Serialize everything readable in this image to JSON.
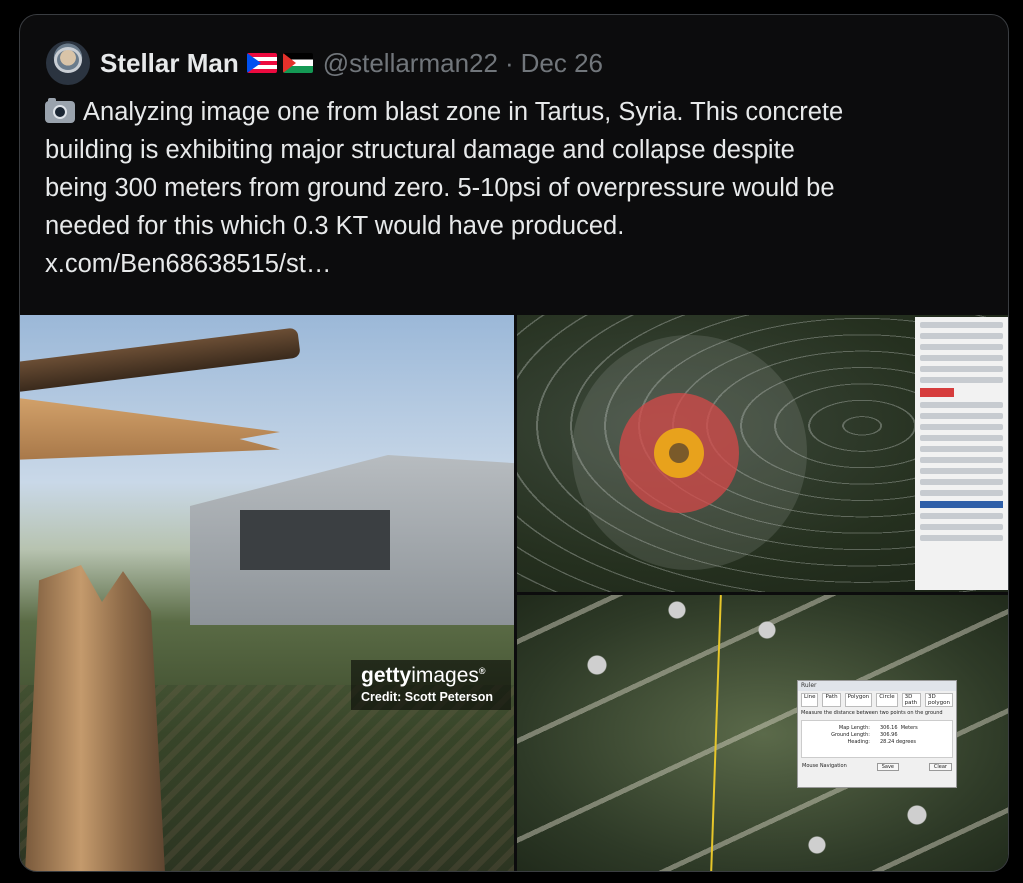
{
  "post": {
    "author_name": "Stellar Man",
    "flags": [
      "puerto-rico-flag",
      "palestine-flag"
    ],
    "handle": "@stellarman22",
    "separator": "·",
    "date": "Dec 26",
    "text_lines": [
      "Analyzing image one from blast zone in Tartus, Syria. This concrete",
      "building is exhibiting major structural damage and collapse despite",
      "being 300 meters from ground zero. 5-10psi of overpressure would be",
      "needed for this which 0.3 KT would have produced."
    ],
    "link": "x.com/Ben68638515/st…"
  },
  "media": {
    "image1": {
      "watermark_brand_bold": "getty",
      "watermark_brand_light": "images",
      "watermark_reg": "®",
      "credit": "Credit: Scott Peterson"
    },
    "image2": {
      "rings": [
        "outer",
        "red",
        "orange"
      ],
      "accent_colors": {
        "outer": "#aaafaa",
        "red": "#d64848",
        "orange": "#e8a21c"
      }
    },
    "image3": {
      "ruler": {
        "title": "Ruler",
        "tabs": [
          "Line",
          "Path",
          "Polygon",
          "Circle",
          "3D path",
          "3D polygon"
        ],
        "description": "Measure the distance between two points on the ground",
        "rows": [
          {
            "label": "Map Length:",
            "value": "306.16",
            "unit": "Meters"
          },
          {
            "label": "Ground Length:",
            "value": "306.96",
            "unit": ""
          },
          {
            "label": "Heading:",
            "value": "28.24 degrees",
            "unit": ""
          }
        ],
        "mouse_nav": "Mouse Navigation",
        "save": "Save",
        "clear": "Clear"
      }
    }
  },
  "colors": {
    "background": "#000000",
    "card": "#0c0c0d",
    "text": "#e7e9ea",
    "muted": "#71767b"
  }
}
